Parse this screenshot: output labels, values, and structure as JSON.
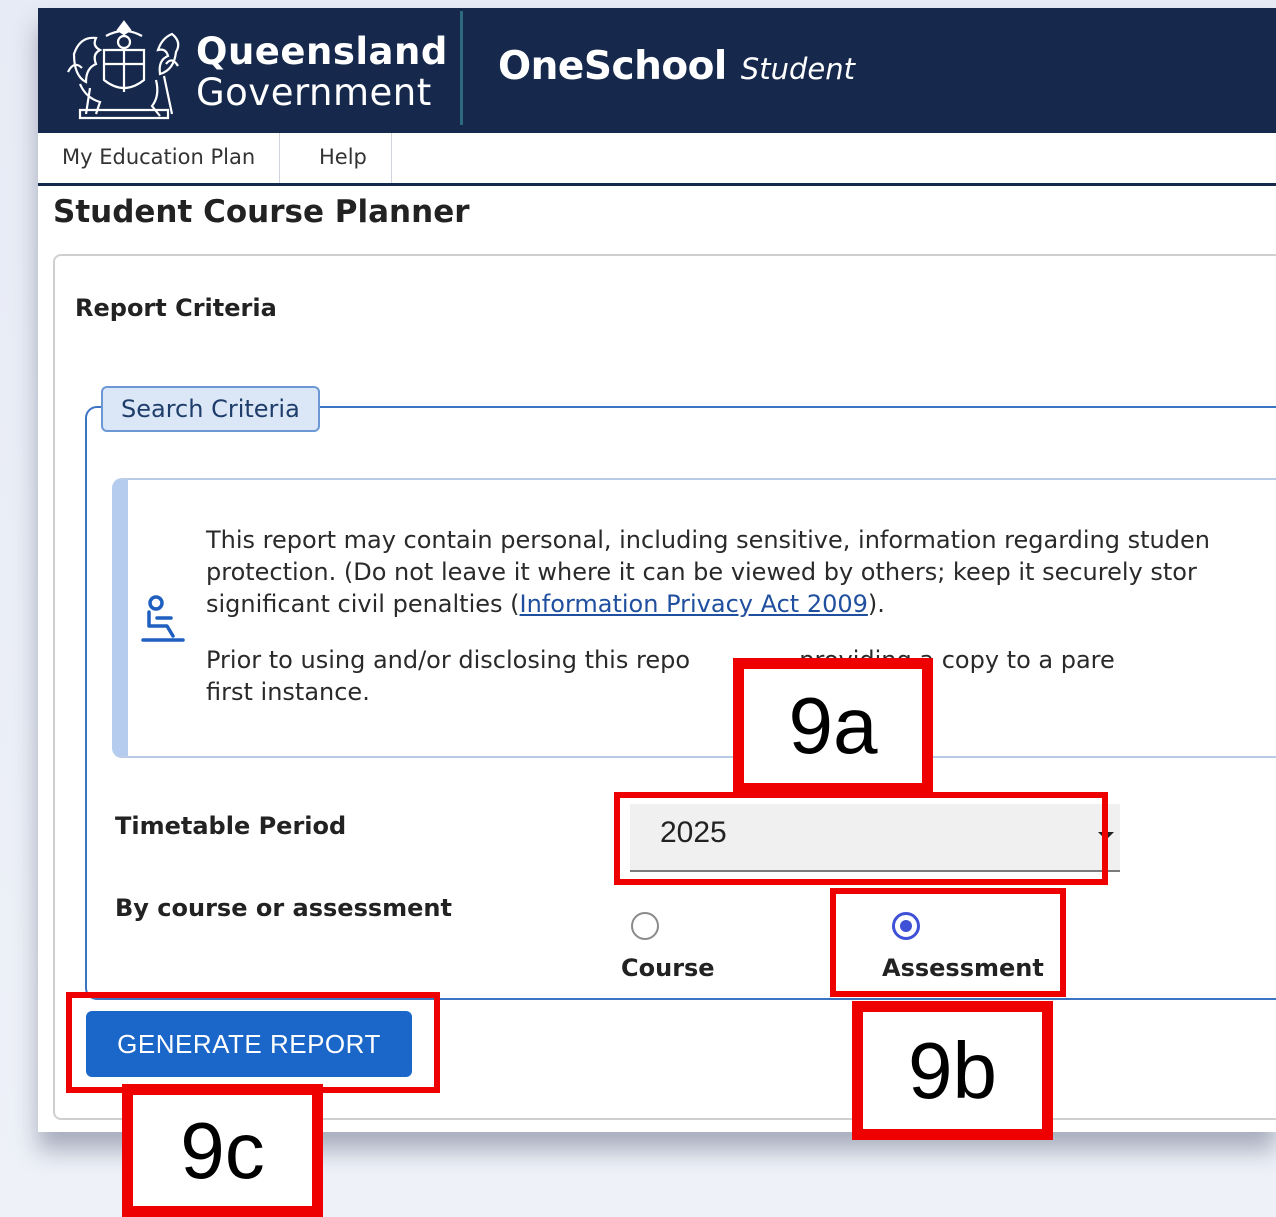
{
  "header": {
    "gov_line1": "Queensland",
    "gov_line2": "Government",
    "app_name": "OneSchool",
    "app_sub": "Student"
  },
  "nav": {
    "items": [
      {
        "label": "My Education Plan"
      },
      {
        "label": "Help"
      }
    ]
  },
  "page": {
    "title": "Student Course Planner"
  },
  "panel": {
    "heading": "Report Criteria",
    "fieldset_legend": "Search Criteria",
    "notice": {
      "line1": "This report may contain personal, including sensitive, information regarding studen",
      "line2": "protection. (Do not leave it where it can be viewed by others; keep it securely stor",
      "line3_pre": "significant civil penalties (",
      "line3_link": "Information Privacy Act 2009",
      "line3_post": ").",
      "para2_line1": "Prior to using and/or disclosing this repo",
      "para2_line1_tail": ". providing a copy to a pare",
      "para2_line2": "first instance."
    },
    "timetable_period": {
      "label": "Timetable Period",
      "value": "2025"
    },
    "by_course": {
      "label": "By course or assessment",
      "options": [
        {
          "label": "Course",
          "checked": false
        },
        {
          "label": "Assessment",
          "checked": true
        }
      ]
    },
    "generate_button": "GENERATE REPORT"
  },
  "annotations": {
    "a": "9a",
    "b": "9b",
    "c": "9c",
    "color": "#ee0000"
  },
  "colors": {
    "header_bg": "#16294d",
    "button_bg": "#1a66c9",
    "radio_accent": "#3f51d6"
  }
}
